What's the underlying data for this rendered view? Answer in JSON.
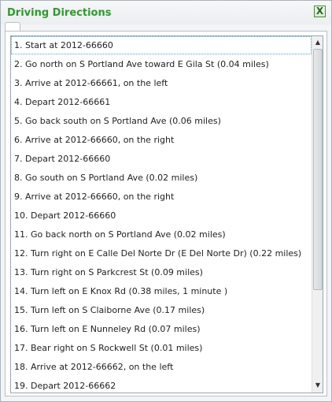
{
  "window": {
    "title": "Driving Directions",
    "close_label": "X"
  },
  "steps": [
    "1. Start at 2012-66660",
    "2. Go north on S Portland Ave toward E Gila St (0.04 miles)",
    "3. Arrive at 2012-66661, on the left",
    "4. Depart 2012-66661",
    "5. Go back south on S Portland Ave (0.06 miles)",
    "6. Arrive at 2012-66660, on the right",
    "7. Depart 2012-66660",
    "8. Go south on S Portland Ave (0.02 miles)",
    "9. Arrive at 2012-66660, on the right",
    "10. Depart 2012-66660",
    "11. Go back north on S Portland Ave (0.02 miles)",
    "12. Turn right on E Calle Del Norte Dr (E Del Norte Dr) (0.22 miles)",
    "13. Turn right on S Parkcrest St (0.09 miles)",
    "14. Turn left on E Knox Rd (0.38 miles, 1 minute )",
    "15. Turn left on S Claiborne Ave (0.17 miles)",
    "16. Turn left on E Nunneley Rd (0.07 miles)",
    "17. Bear right on S Rockwell St (0.01 miles)",
    "18. Arrive at 2012-66662, on the left",
    "19. Depart 2012-66662"
  ],
  "selected_index": 0,
  "icons": {
    "scroll_up": "scroll-up-arrow-icon",
    "scroll_down": "scroll-down-arrow-icon"
  },
  "colors": {
    "title": "#2f9a2f",
    "selection_border": "#47a7c7"
  }
}
